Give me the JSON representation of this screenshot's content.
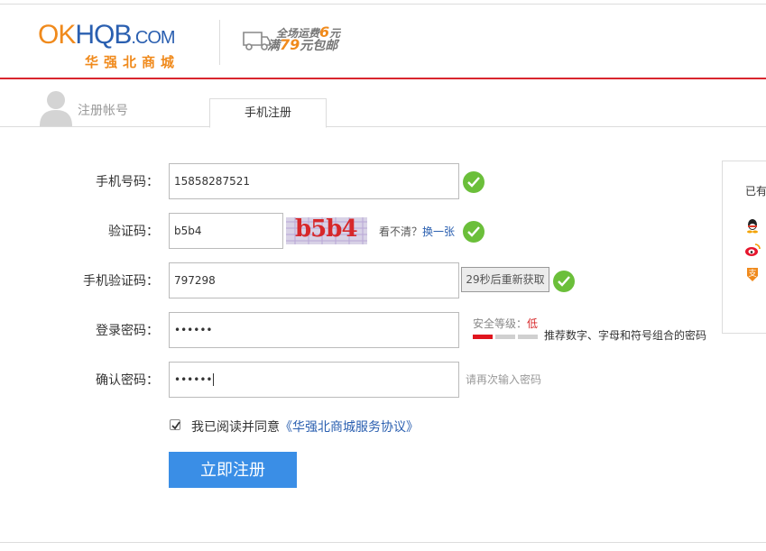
{
  "header": {
    "logo_main_o": "OK",
    "logo_main_b": "HQB",
    "logo_com": ".COM",
    "logo_sub": "华强北商城",
    "promo_line1_prefix": "全场运费",
    "promo_line1_num": "6",
    "promo_line1_suffix": "元",
    "promo_line2_prefix": "满",
    "promo_line2_num": "79",
    "promo_line2_suffix": "元包邮"
  },
  "register": {
    "title": "注册帐号",
    "tab": "手机注册"
  },
  "form": {
    "phone": {
      "label": "手机号码：",
      "value": "15858287521"
    },
    "captcha": {
      "label": "验证码：",
      "value": "b5b4",
      "image_text": "b5b4",
      "hint": "看不清？",
      "refresh_link": "换一张"
    },
    "sms": {
      "label": "手机验证码：",
      "value": "797298",
      "button": "29秒后重新获取"
    },
    "password": {
      "label": "登录密码：",
      "value": "••••••",
      "strength_label": "安全等级：",
      "strength_value": "低",
      "strength_level": 1,
      "strength_max": 3,
      "tip": "推荐数字、字母和符号组合的密码"
    },
    "confirm": {
      "label": "确认密码：",
      "value": "••••••",
      "tip": "请再次输入密码"
    },
    "agree": {
      "checked": true,
      "text": "我已阅读并同意",
      "link": "《华强北商城服务协议》"
    },
    "submit": "立即注册"
  },
  "side_panel": {
    "title": "已有",
    "icons": [
      "qq-icon",
      "weibo-icon",
      "alipay-icon"
    ]
  },
  "colors": {
    "accent_red": "#d9262e",
    "brand_orange": "#f08a1c",
    "brand_blue": "#2a5fb0",
    "button_blue": "#3a8ee6",
    "check_green": "#6bbf3a"
  }
}
